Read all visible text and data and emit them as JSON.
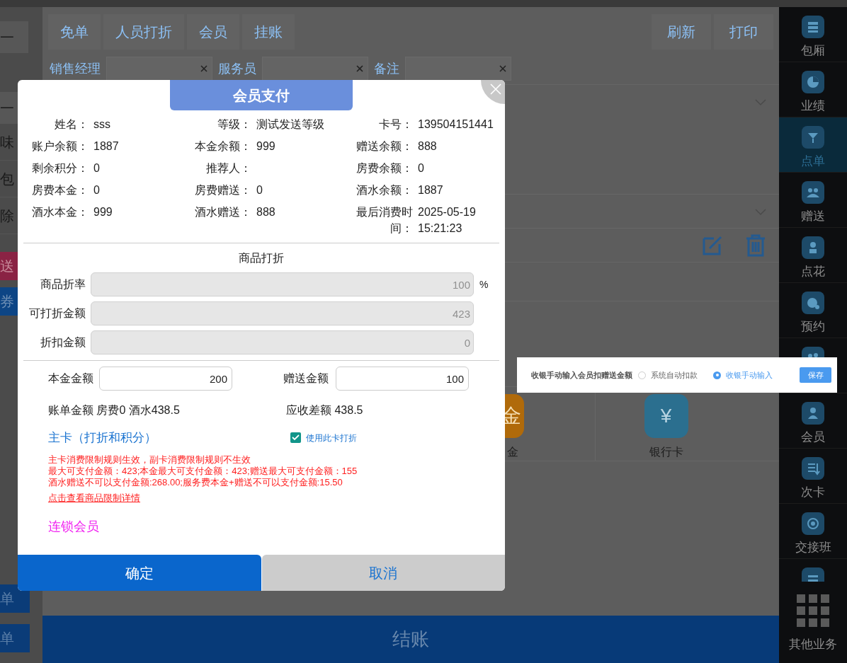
{
  "left_panel": {
    "items": [
      {
        "text": "一",
        "kind": "boxed"
      },
      {
        "text": "一",
        "kind": "boxed"
      },
      {
        "text": "味",
        "kind": "plain"
      },
      {
        "text": "包",
        "kind": "plain"
      },
      {
        "text": "除",
        "kind": "plain"
      },
      {
        "text": "送",
        "kind": "red"
      },
      {
        "text": "券",
        "kind": "blue"
      }
    ],
    "bottom_buttons": [
      "单",
      "单"
    ]
  },
  "toolbar": {
    "left_buttons": [
      "免单",
      "人员打折",
      "会员",
      "挂账"
    ],
    "right_buttons": [
      "刷新",
      "打印"
    ]
  },
  "filters": [
    {
      "label": "销售经理"
    },
    {
      "label": "服务员"
    },
    {
      "label": "备注"
    }
  ],
  "payment_methods": [
    {
      "icon_text": "金",
      "label": "金",
      "color": "#b06a0a"
    },
    {
      "icon_text": "¥",
      "label": "银行卡",
      "color": "#2b6f8f"
    }
  ],
  "checkout_button": "结账",
  "sidebar": {
    "items": [
      {
        "label": "包厢",
        "selected": false
      },
      {
        "label": "业绩",
        "selected": false
      },
      {
        "label": "点单",
        "selected": true
      },
      {
        "label": "赠送",
        "selected": false
      },
      {
        "label": "点花",
        "selected": false
      },
      {
        "label": "预约",
        "selected": false
      },
      {
        "selected": false
      },
      {
        "label": "会员",
        "selected": false
      },
      {
        "label": "次卡",
        "selected": false
      },
      {
        "label": "交接班",
        "selected": false
      },
      {
        "selected": false
      }
    ],
    "more": "其他业务"
  },
  "member_payment_dialog": {
    "title": "会员支付",
    "info": [
      {
        "label": "姓名：",
        "value": "sss"
      },
      {
        "label": "等级：",
        "value": "测试发送等级"
      },
      {
        "label": "卡号：",
        "value": "139504151441"
      },
      {
        "label": "账户余额：",
        "value": "1887"
      },
      {
        "label": "本金余额：",
        "value": "999"
      },
      {
        "label": "赠送余额：",
        "value": "888"
      },
      {
        "label": "剩余积分：",
        "value": "0"
      },
      {
        "label": "推荐人："
      },
      {
        "label": "房费余额：",
        "value": "0"
      },
      {
        "label": "房费本金：",
        "value": "0"
      },
      {
        "label": "房费赠送：",
        "value": "0"
      },
      {
        "label": "酒水余额：",
        "value": "1887"
      },
      {
        "label": "酒水本金：",
        "value": "999"
      },
      {
        "label": "酒水赠送：",
        "value": "888"
      },
      {
        "label": "最后消费时间：",
        "value": "2025-05-19 15:21:23"
      }
    ],
    "discount_section": {
      "title": "商品打折",
      "fields": [
        {
          "label": "商品折率",
          "value": "100",
          "unit": "%"
        },
        {
          "label": "可打折金额",
          "value": "423"
        },
        {
          "label": "折扣金额",
          "value": "0"
        }
      ]
    },
    "amounts": [
      {
        "label": "本金金额",
        "value": "200"
      },
      {
        "label": "赠送金额",
        "value": "100"
      }
    ],
    "bill_summary": "账单金额 房费0 酒水438.5",
    "difference": "应收差额 438.5",
    "main_card": "主卡（打折和积分）",
    "use_card_discount": {
      "label": "使用此卡打折",
      "checked": true
    },
    "notices": [
      "主卡消费限制规则生效，副卡消费限制规则不生效",
      "最大可支付金额：423;本金最大可支付金额：423;赠送最大可支付金额：155",
      "酒水赠送不可以支付金额:268.00;服务费本金+赠送不可以支付金额:15.50"
    ],
    "detail_link": "点击查看商品限制详情",
    "chain_member": "连锁会员",
    "buttons": [
      {
        "label": "确定",
        "kind": "primary"
      },
      {
        "label": "取消",
        "kind": "secondary"
      }
    ]
  },
  "manual_deduct_setting": {
    "label": "收银手动输入会员扣赠送金额",
    "options": [
      {
        "label": "系统自动扣款",
        "selected": false
      },
      {
        "label": "收银手动输入",
        "selected": true
      }
    ],
    "save_button": "保存"
  }
}
